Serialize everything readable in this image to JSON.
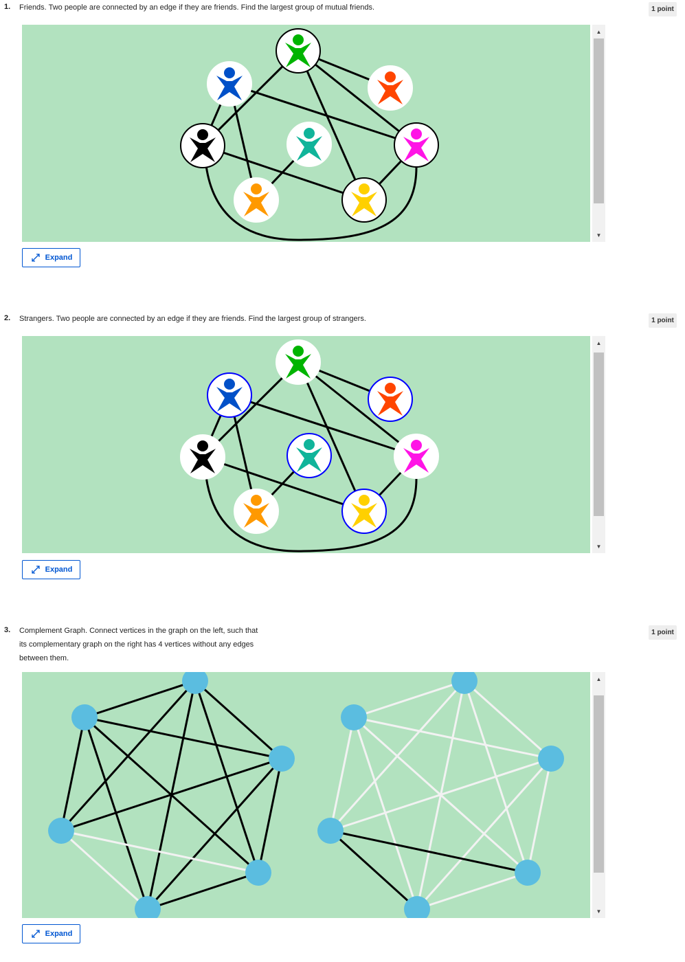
{
  "questions": [
    {
      "number": "1.",
      "text": "Friends. Two people are connected by an edge if they are friends. Find the largest group of mutual friends.",
      "points": "1 point",
      "expand_label": "Expand"
    },
    {
      "number": "2.",
      "text": "Strangers. Two people are connected by an edge if they are friends. Find the largest group of strangers.",
      "points": "1 point",
      "expand_label": "Expand"
    },
    {
      "number": "3.",
      "text_lines": [
        "Complement Graph. Connect vertices in the graph on the left, such that",
        "its complementary graph on the right has 4 vertices without any edges",
        "between them."
      ],
      "points": "1 point",
      "expand_label": "Expand"
    }
  ],
  "colors": {
    "panel_bg": "#b2e2bf",
    "accent": "#0056d2",
    "vertex": "#5bbde0",
    "people": [
      "#00b400",
      "#0050c8",
      "#ff4500",
      "#000000",
      "#10b49a",
      "#ff14e6",
      "#ff9900",
      "#ffd000"
    ]
  },
  "icons": {
    "person": "person-icon",
    "expand": "expand-arrows-icon",
    "scroll_up": "triangle-up-icon",
    "scroll_down": "triangle-down-icon"
  }
}
